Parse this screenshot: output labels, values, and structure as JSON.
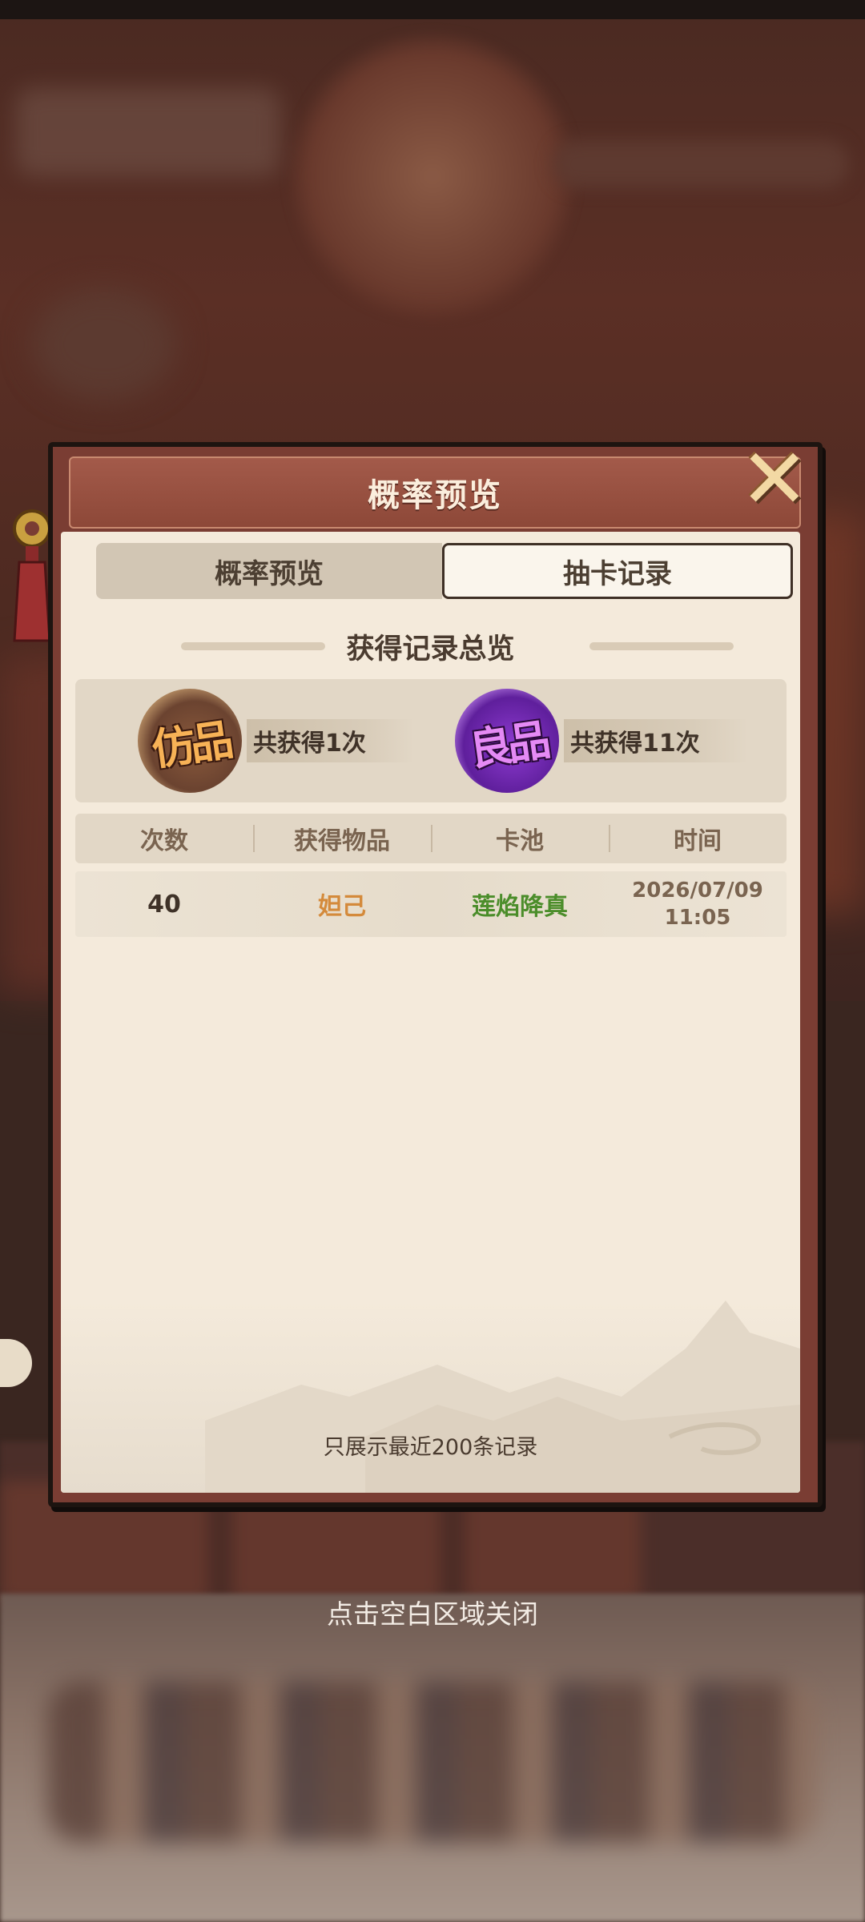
{
  "dialog": {
    "title": "概率预览",
    "tabs": [
      {
        "label": "概率预览",
        "selected": false
      },
      {
        "label": "抽卡记录",
        "selected": true
      }
    ],
    "summary_title": "获得记录总览",
    "grades": [
      {
        "badge": "仿品",
        "count_text": "共获得1次",
        "color": "#f7b256"
      },
      {
        "badge": "良品",
        "count_text": "共获得11次",
        "color": "#e58af5"
      }
    ],
    "table": {
      "headers": [
        "次数",
        "获得物品",
        "卡池",
        "时间"
      ],
      "rows": [
        {
          "count": "40",
          "item": "妲己",
          "pool": "莲焰降真",
          "date": "2026/07/09",
          "time": "11:05"
        }
      ]
    },
    "footer_note": "只展示最近200条记录"
  },
  "close_hint": "点击空白区域关闭",
  "icons": {
    "close": "close-icon"
  },
  "colors": {
    "item_orange": "#d48a3b",
    "pool_green": "#4b8d2a",
    "header_red": "#8d4838",
    "panel_bg": "#f4eadb"
  }
}
